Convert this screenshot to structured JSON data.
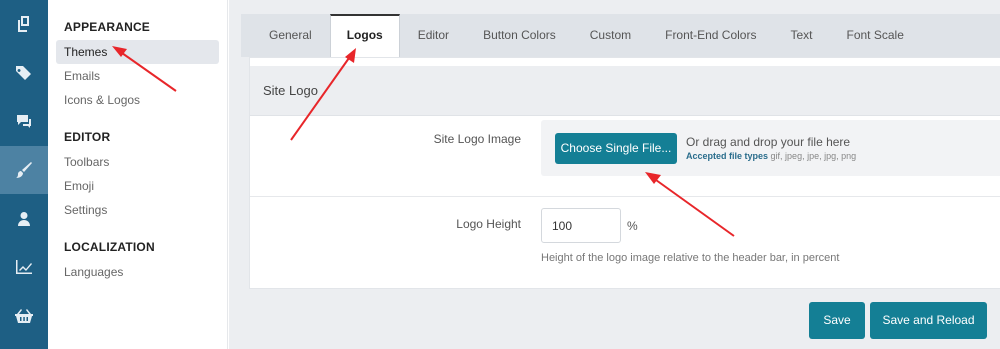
{
  "rail": {
    "items": [
      {
        "icon": "pages-icon",
        "active": false
      },
      {
        "icon": "tags-icon",
        "active": false
      },
      {
        "icon": "chat-icon",
        "active": false
      },
      {
        "icon": "brush-icon",
        "active": true
      },
      {
        "icon": "user-icon",
        "active": false
      },
      {
        "icon": "chart-icon",
        "active": false
      },
      {
        "icon": "basket-icon",
        "active": false
      }
    ]
  },
  "sidebar": {
    "groups": [
      {
        "heading": "APPEARANCE",
        "items": [
          "Themes",
          "Emails",
          "Icons & Logos"
        ]
      },
      {
        "heading": "EDITOR",
        "items": [
          "Toolbars",
          "Emoji",
          "Settings"
        ]
      },
      {
        "heading": "LOCALIZATION",
        "items": [
          "Languages"
        ]
      }
    ]
  },
  "tabs": [
    "General",
    "Logos",
    "Editor",
    "Button Colors",
    "Custom",
    "Front-End Colors",
    "Text",
    "Font Scale"
  ],
  "panel": {
    "title": "Site Logo",
    "logo_image": {
      "label": "Site Logo Image",
      "button": "Choose Single File...",
      "drop_text": "Or drag and drop your file here",
      "accepted_label": "Accepted file types",
      "accepted_types": "gif, jpeg, jpe, jpg, png"
    },
    "logo_height": {
      "label": "Logo Height",
      "value": "100",
      "unit": "%",
      "hint": "Height of the logo image relative to the header bar, in percent"
    }
  },
  "actions": {
    "save": "Save",
    "save_reload": "Save and Reload"
  },
  "colors": {
    "rail": "#1e5f84",
    "accent": "#147f95",
    "annotation": "#e8262a"
  }
}
